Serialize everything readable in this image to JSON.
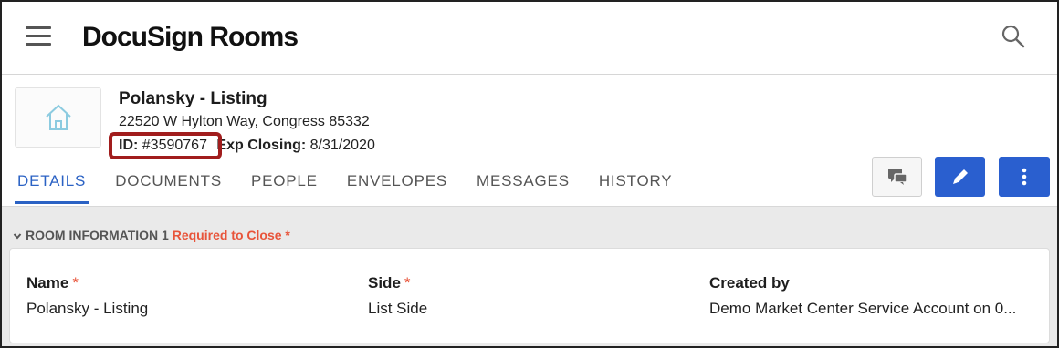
{
  "header": {
    "logo": "DocuSign Rooms",
    "menu_icon": "hamburger-menu-icon",
    "search_icon": "search-icon"
  },
  "room": {
    "title": "Polansky - Listing",
    "address": "22520 W Hylton Way, Congress 85332",
    "id_label": "ID:",
    "id_value": "#3590767",
    "exp_label": "Exp Closing:",
    "exp_value": "8/31/2020",
    "thumbnail_icon": "house-icon"
  },
  "tabs": [
    {
      "label": "DETAILS",
      "active": true
    },
    {
      "label": "DOCUMENTS"
    },
    {
      "label": "PEOPLE"
    },
    {
      "label": "ENVELOPES"
    },
    {
      "label": "MESSAGES"
    },
    {
      "label": "HISTORY"
    }
  ],
  "actions": {
    "message_icon": "chat-bubbles-icon",
    "edit_icon": "pencil-icon",
    "more_icon": "vertical-dots-icon"
  },
  "section": {
    "title": "ROOM INFORMATION 1",
    "required_text": "Required to Close *",
    "collapse_icon": "chevron-down-icon",
    "fields": [
      {
        "label": "Name",
        "required_mark": "*",
        "value": "Polansky - Listing"
      },
      {
        "label": "Side",
        "required_mark": "*",
        "value": "List Side"
      },
      {
        "label": "Created by",
        "value": "Demo Market Center Service Account on 0..."
      }
    ]
  },
  "colors": {
    "accent": "#2a5fcf",
    "required": "#e8543a",
    "highlight_box": "#a11d1d"
  }
}
